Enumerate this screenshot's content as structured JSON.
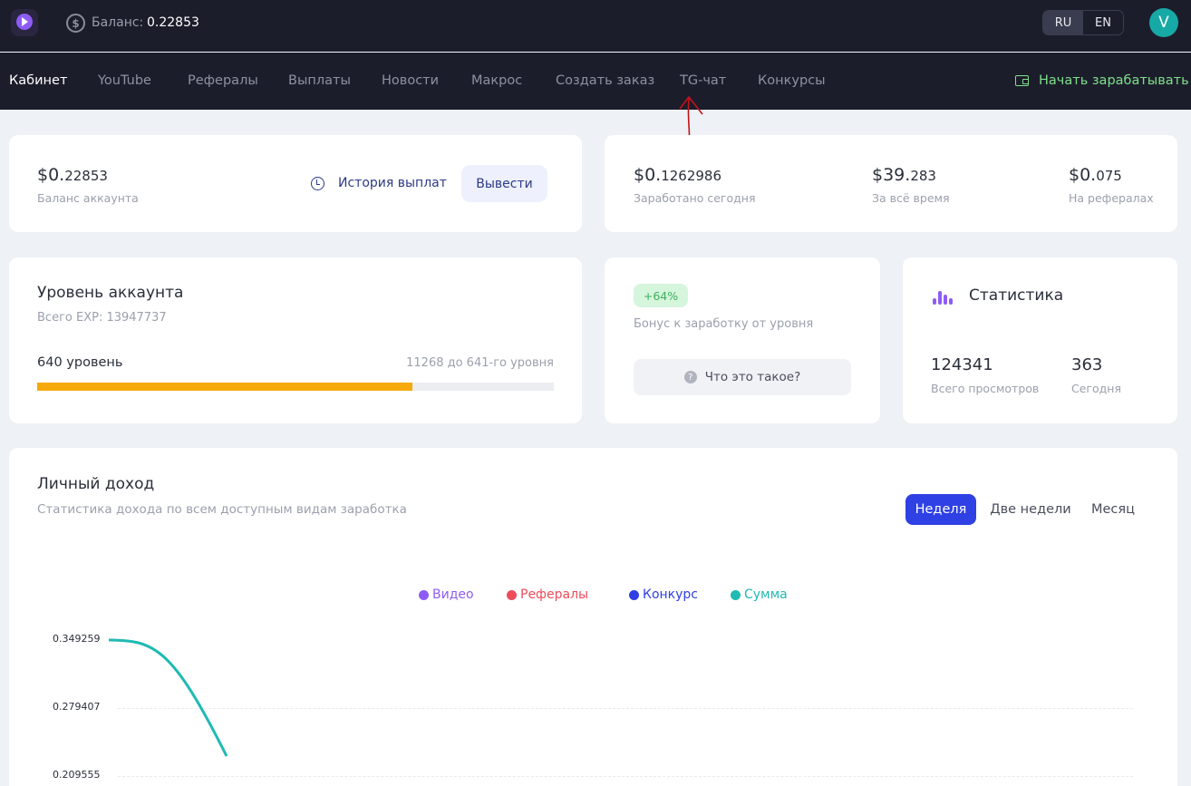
{
  "header": {
    "balance_label": "Баланс:",
    "balance_value": "0.22853",
    "balance_icon": "dollar-circle-icon",
    "languages": [
      "RU",
      "EN"
    ],
    "active_language": "RU",
    "avatar_letter": "V"
  },
  "nav": {
    "items": [
      "Кабинет",
      "YouTube",
      "Рефералы",
      "Выплаты",
      "Новости",
      "Макрос",
      "Создать заказ",
      "TG-чат",
      "Конкурсы"
    ],
    "active": "Кабинет",
    "earn_label": "Начать зарабатывать",
    "earn_color": "#7ee08a"
  },
  "balance_card": {
    "value_main": "$0.",
    "value_dec": "22853",
    "label": "Баланс аккаунта",
    "history_label": "История выплат",
    "withdraw_label": "Вывести"
  },
  "earnings_card": {
    "today_main": "$0.",
    "today_dec": "1262986",
    "today_label": "Заработано сегодня",
    "total_main": "$39.",
    "total_dec": "283",
    "total_label": "За всё время",
    "referrals_main": "$0.",
    "referrals_dec": "075",
    "referrals_label": "На рефералах"
  },
  "level_card": {
    "title": "Уровень аккаунта",
    "exp_text": "Всего EXP: 13947737",
    "level_text": "640 уровень",
    "next_text": "11268 до 641-го уровня",
    "progress_fraction": 0.727,
    "progress_color": "#f6a90a"
  },
  "bonus_card": {
    "badge": "+64%",
    "label": "Бонус к заработку от уровня",
    "what_label": "Что это такое?"
  },
  "stats_card": {
    "title": "Статистика",
    "views_value": "124341",
    "views_label": "Всего просмотров",
    "today_value": "363",
    "today_label": "Сегодня"
  },
  "income": {
    "title": "Личный доход",
    "subtitle": "Статистика дохода по всем доступным видам заработка",
    "periods": [
      "Неделя",
      "Две недели",
      "Месяц"
    ],
    "active_period": "Неделя",
    "accent": "#2f40e4"
  },
  "chart_data": {
    "type": "line",
    "legend": [
      {
        "name": "Видео",
        "color": "#8e5cf4"
      },
      {
        "name": "Рефералы",
        "color": "#ee4b5b"
      },
      {
        "name": "Конкурс",
        "color": "#2f40e4"
      },
      {
        "name": "Сумма",
        "color": "#1fbab3"
      }
    ],
    "y_ticks": [
      "0.349259",
      "0.279407",
      "0.209555"
    ],
    "series": [
      {
        "name": "Сумма",
        "values": [
          0.349259,
          0.23
        ]
      }
    ],
    "legend_position": "top-center",
    "grid": true
  }
}
